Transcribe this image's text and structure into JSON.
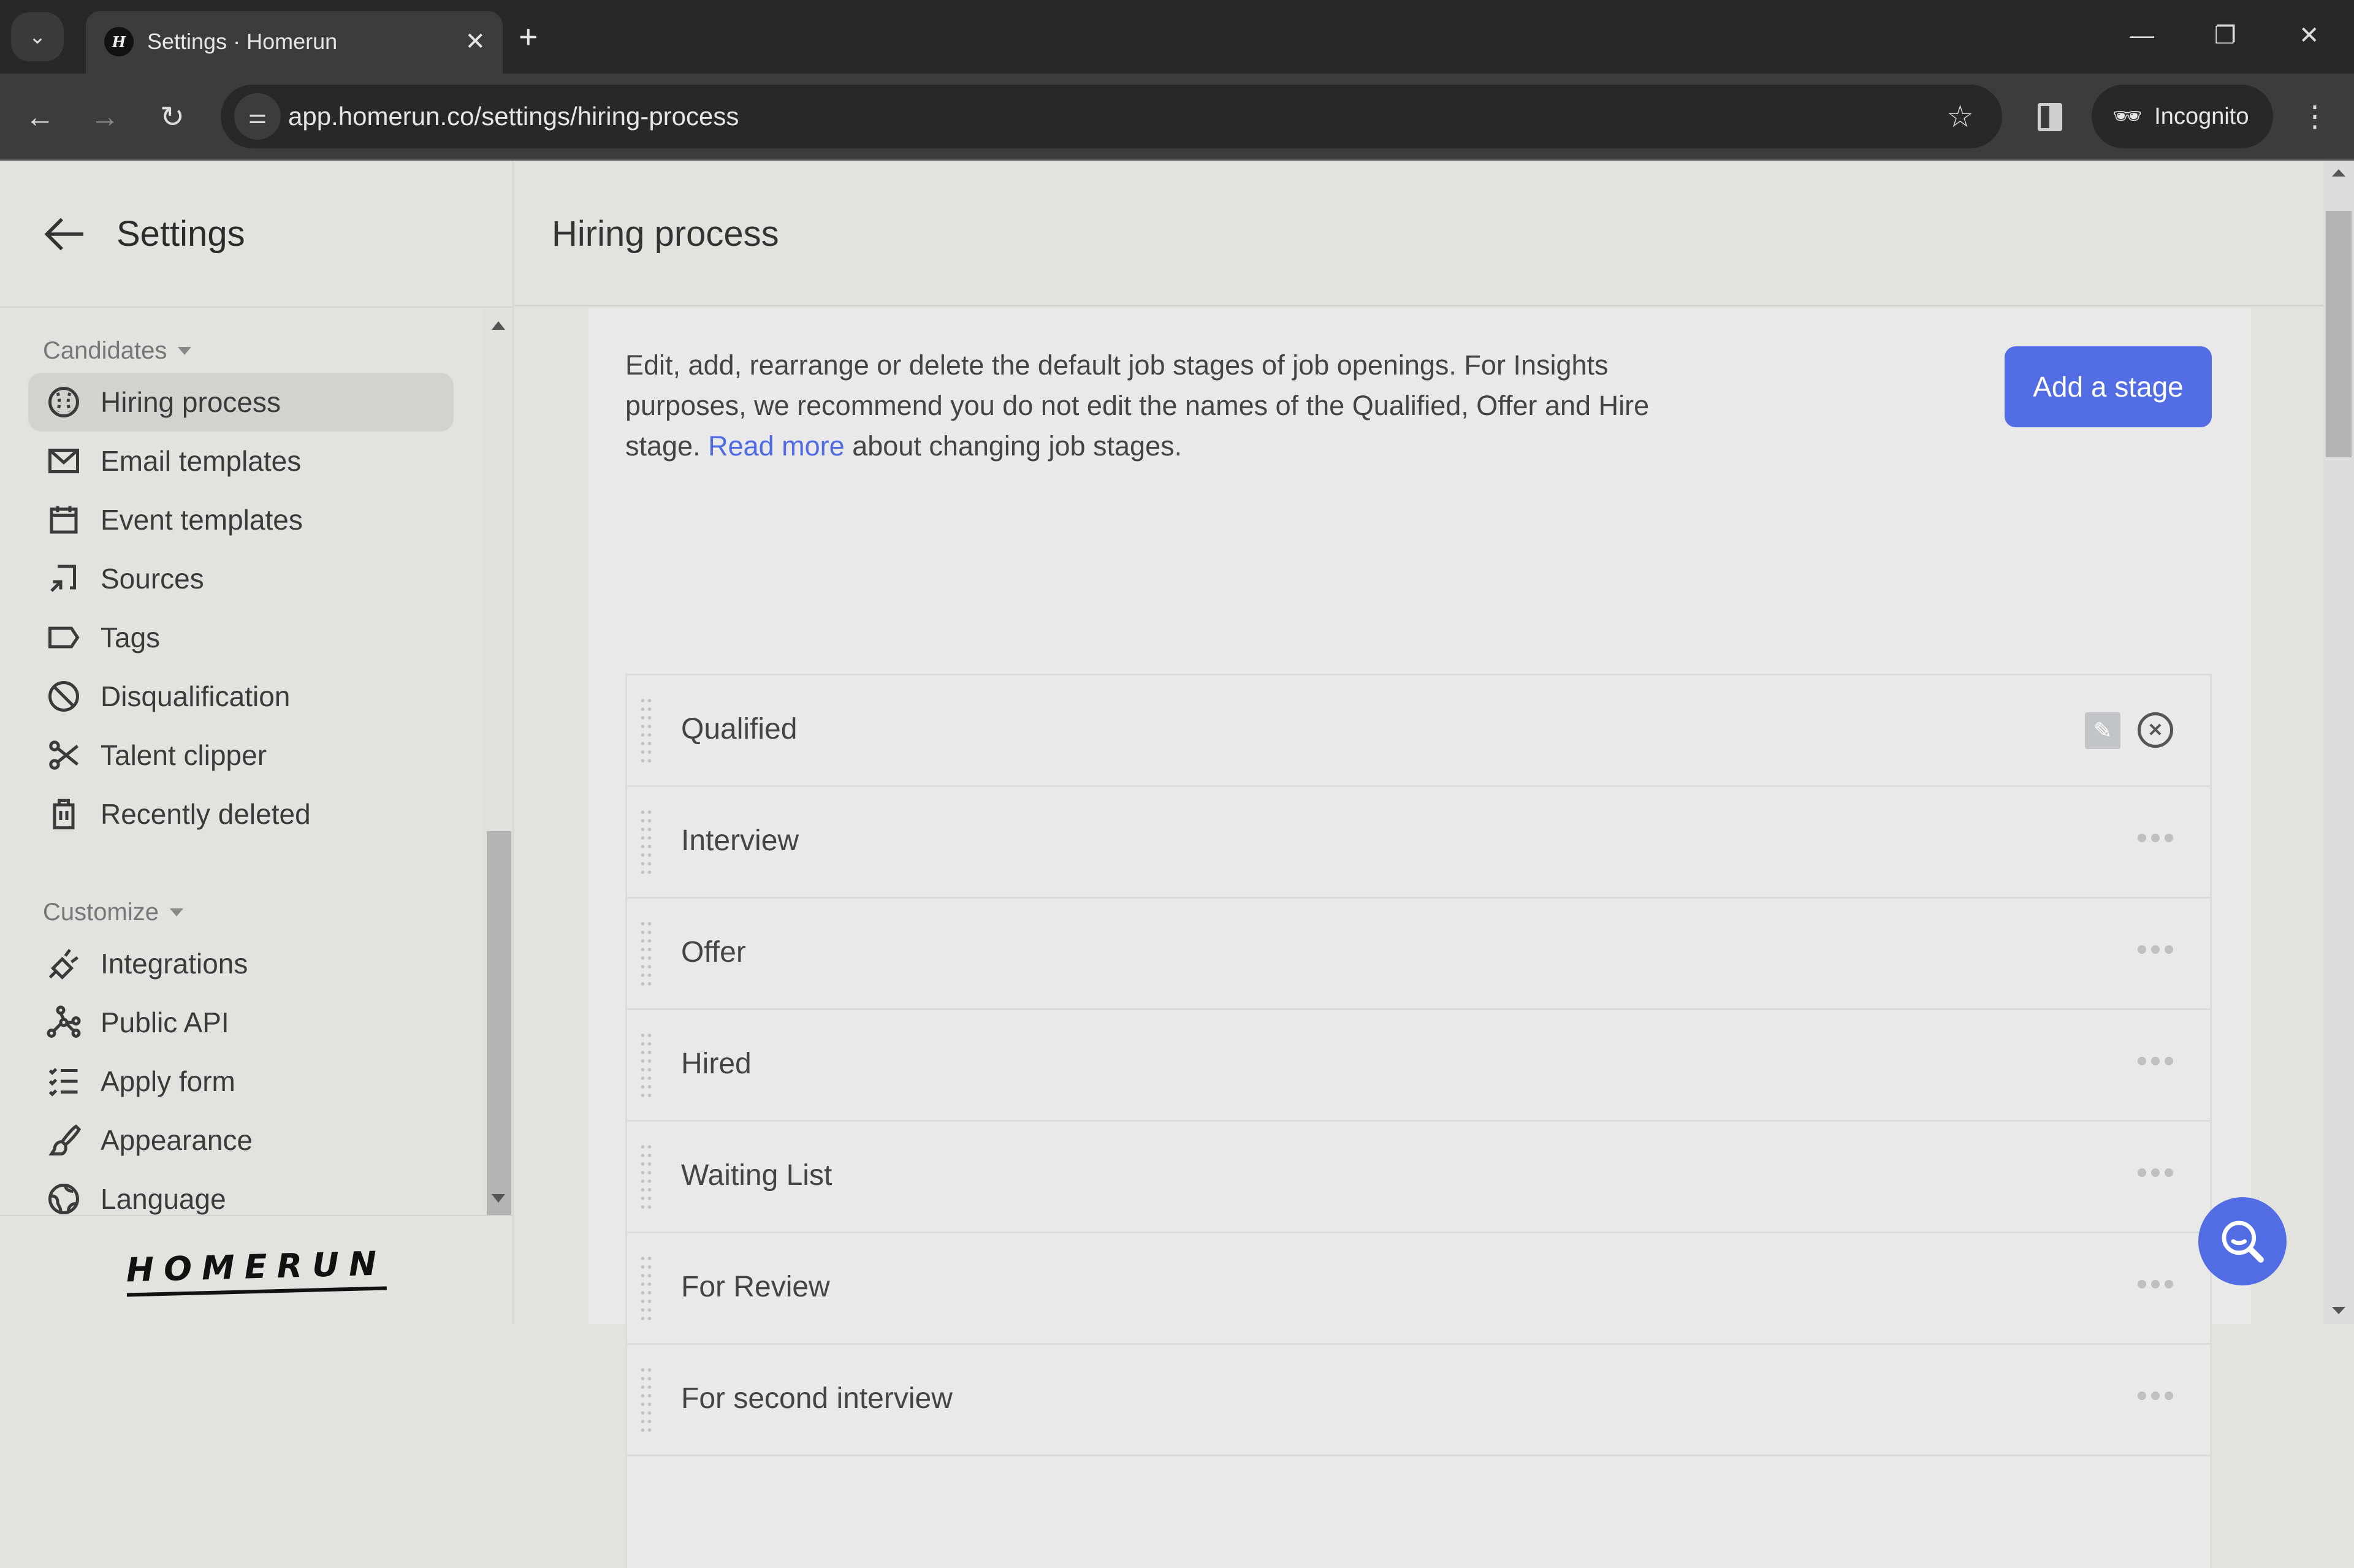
{
  "browser": {
    "tab_title": "Settings · Homerun",
    "tab_favicon": "H",
    "url": "app.homerun.co/settings/hiring-process",
    "incognito_label": "Incognito"
  },
  "sidebar": {
    "title": "Settings",
    "sections": [
      {
        "label": "Candidates",
        "items": [
          {
            "label": "Hiring process",
            "icon": "baseball-icon",
            "active": true
          },
          {
            "label": "Email templates",
            "icon": "envelope-icon"
          },
          {
            "label": "Event templates",
            "icon": "calendar-icon"
          },
          {
            "label": "Sources",
            "icon": "sources-arrow-icon"
          },
          {
            "label": "Tags",
            "icon": "tag-icon"
          },
          {
            "label": "Disqualification",
            "icon": "prohibited-icon"
          },
          {
            "label": "Talent clipper",
            "icon": "scissors-icon"
          },
          {
            "label": "Recently deleted",
            "icon": "trash-icon"
          }
        ]
      },
      {
        "label": "Customize",
        "items": [
          {
            "label": "Integrations",
            "icon": "plug-icon"
          },
          {
            "label": "Public API",
            "icon": "network-icon"
          },
          {
            "label": "Apply form",
            "icon": "checklist-icon"
          },
          {
            "label": "Appearance",
            "icon": "paintbrush-icon"
          },
          {
            "label": "Language",
            "icon": "globe-icon"
          }
        ]
      }
    ],
    "logo": "HOMERUN"
  },
  "main": {
    "title": "Hiring process",
    "description_before_link": "Edit, add, rearrange or delete the default job stages of job openings. For Insights purposes, we recommend you do not edit the names of the Qualified, Offer and Hire stage. ",
    "link_text": "Read more",
    "description_after_link": " about changing job stages.",
    "add_button": "Add a stage",
    "stages": [
      {
        "name": "Qualified",
        "hovered": true
      },
      {
        "name": "Interview"
      },
      {
        "name": "Offer"
      },
      {
        "name": "Hired"
      },
      {
        "name": "Waiting List"
      },
      {
        "name": "For Review"
      },
      {
        "name": "For second interview"
      }
    ]
  },
  "colors": {
    "accent": "#526ce3",
    "link": "#4f6ae3",
    "background": "#e2e2df",
    "card": "#e9e9e9"
  }
}
